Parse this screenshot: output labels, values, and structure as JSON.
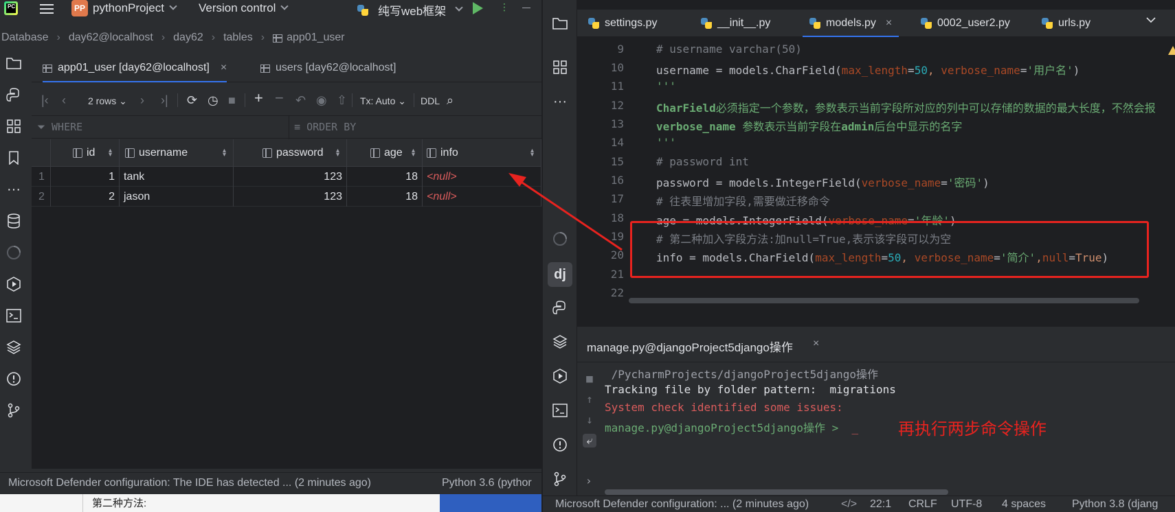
{
  "left_window": {
    "app_icon_label": "PC",
    "project_badge": "PP",
    "project_name": "pythonProject",
    "version_control": "Version control",
    "run_config": "纯写web框架",
    "breadcrumb": [
      "Database",
      "day62@localhost",
      "day62",
      "tables",
      "app01_user"
    ],
    "tabs": [
      {
        "label": "app01_user [day62@localhost]",
        "active": true,
        "close": "×"
      },
      {
        "label": "users [day62@localhost]",
        "active": false
      }
    ],
    "toolbar": {
      "rows": "2 rows",
      "tx": "Tx: Auto",
      "ddl": "DDL"
    },
    "filter": {
      "where": "WHERE",
      "order_by": "ORDER BY"
    },
    "grid": {
      "columns": [
        "id",
        "username",
        "password",
        "age",
        "info"
      ],
      "rows": [
        {
          "num": "1",
          "id": "1",
          "username": "tank",
          "password": "123",
          "age": "18",
          "info": "<null>"
        },
        {
          "num": "2",
          "id": "2",
          "username": "jason",
          "password": "123",
          "age": "18",
          "info": "<null>"
        }
      ]
    },
    "status": {
      "message": "Microsoft Defender configuration: The IDE has detected ... (2 minutes ago)",
      "interpreter": "Python 3.6 (pythor"
    },
    "under_doc_text": "第二种方法:"
  },
  "right_window": {
    "tabs": [
      {
        "label": "settings.py"
      },
      {
        "label": "__init__.py"
      },
      {
        "label": "models.py",
        "active": true,
        "close": "×"
      },
      {
        "label": "0002_user2.py"
      },
      {
        "label": "urls.py"
      }
    ],
    "warning_count": "1",
    "line_numbers": [
      "9",
      "10",
      "11",
      "12",
      "13",
      "14",
      "15",
      "16",
      "17",
      "18",
      "19",
      "20",
      "21",
      "22"
    ],
    "code": {
      "l9": "# username varchar(50)",
      "l10_a": "username = models.CharField(",
      "l10_p1": "max_length",
      "l10_eq": "=",
      "l10_n": "50",
      "l10_c": ", ",
      "l10_p2": "verbose_name",
      "l10_eq2": "=",
      "l10_s": "'用户名'",
      "l10_end": ")",
      "l11": "'''",
      "l12_a": "CharField",
      "l12_b": "必须指定一个参数，参数表示当前字段所对应的列中可以存储的数据的最大长度，不然会报",
      "l13_a": "verbose_name",
      "l13_b": " 参数表示当前字段在",
      "l13_c": "admin",
      "l13_d": "后台中显示的名字",
      "l14": "'''",
      "l15": "# password int",
      "l16_a": "password = models.IntegerField(",
      "l16_p": "verbose_name",
      "l16_eq": "=",
      "l16_s": "'密码'",
      "l16_end": ")",
      "l17": "# 往表里增加字段,需要做迁移命令",
      "l18_a": "age = models.IntegerField(",
      "l18_p": "verbose_name",
      "l18_eq": "=",
      "l18_s": "'年龄'",
      "l18_end": ")",
      "l19": "# 第二种加入字段方法:加null=True,表示该字段可以为空",
      "l20_a": "info = models.CharField(",
      "l20_p1": "max_length",
      "l20_eq": "=",
      "l20_n": "50",
      "l20_c": ", ",
      "l20_p2": "verbose_name",
      "l20_eq2": "=",
      "l20_s": "'简介'",
      "l20_c2": ",",
      "l20_p3": "null",
      "l20_eq3": "=",
      "l20_kw": "True",
      "l20_end": ")"
    },
    "terminal": {
      "title": "manage.py@djangoProject5django操作",
      "close": "×",
      "lines": {
        "path": " /PycharmProjects/djangoProject5django操作",
        "tracking": "Tracking file by folder pattern:  migrations",
        "check": "System check identified some issues:",
        "prompt": "manage.py@djangoProject5django操作 > ",
        "caret": "_"
      }
    },
    "status": {
      "message": "Microsoft Defender configuration: ... (2 minutes ago)",
      "position": "22:1",
      "line_sep": "CRLF",
      "encoding": "UTF-8",
      "indent": "4 spaces",
      "interpreter": "Python 3.8 (djang"
    }
  },
  "annotation": {
    "note": "再执行两步命令操作",
    "color": "#e8231f"
  },
  "colors": {
    "accent": "#3574f0",
    "null_text": "#db5c5c",
    "string": "#6aab73",
    "keyword": "#cf8e6d"
  }
}
